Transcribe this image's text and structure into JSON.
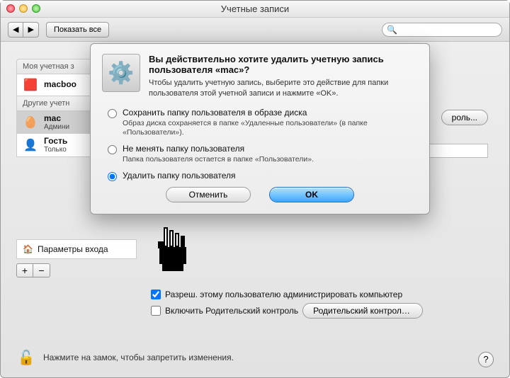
{
  "window": {
    "title": "Учетные записи"
  },
  "toolbar": {
    "back": "◀",
    "forward": "▶",
    "show_all": "Показать все",
    "search_placeholder": ""
  },
  "sidebar": {
    "my_account_label": "Моя учетная з",
    "other_accounts_label": "Другие учетн",
    "items": [
      {
        "name": "macboo",
        "role": ""
      },
      {
        "name": "mac",
        "role": "Админи"
      },
      {
        "name": "Гость",
        "role": "Только"
      }
    ],
    "login_options": "Параметры входа",
    "plus": "+",
    "minus": "−"
  },
  "main": {
    "obscured_button": "роль...",
    "allow_admin": "Разреш. этому пользователю администрировать компьютер",
    "parental_enable": "Включить Родительский контроль",
    "parental_button": "Родительский контроль..."
  },
  "lock": {
    "text": "Нажмите на замок, чтобы запретить изменения."
  },
  "help": {
    "label": "?"
  },
  "dialog": {
    "title": "Вы действительно хотите удалить учетную запись пользователя «mac»?",
    "desc": "Чтобы удалить учетную запись, выберите это действие для папки пользователя этой учетной записи и нажмите «OK».",
    "options": [
      {
        "label": "Сохранить папку пользователя в образе диска",
        "sub": "Образ диска сохраняется в папке «Удаленные пользователи» (в папке «Пользователи»)."
      },
      {
        "label": "Не менять папку пользователя",
        "sub": "Папка пользователя остается в папке «Пользователи»."
      },
      {
        "label": "Удалить папку пользователя",
        "sub": ""
      }
    ],
    "cancel": "Отменить",
    "ok": "OK"
  }
}
